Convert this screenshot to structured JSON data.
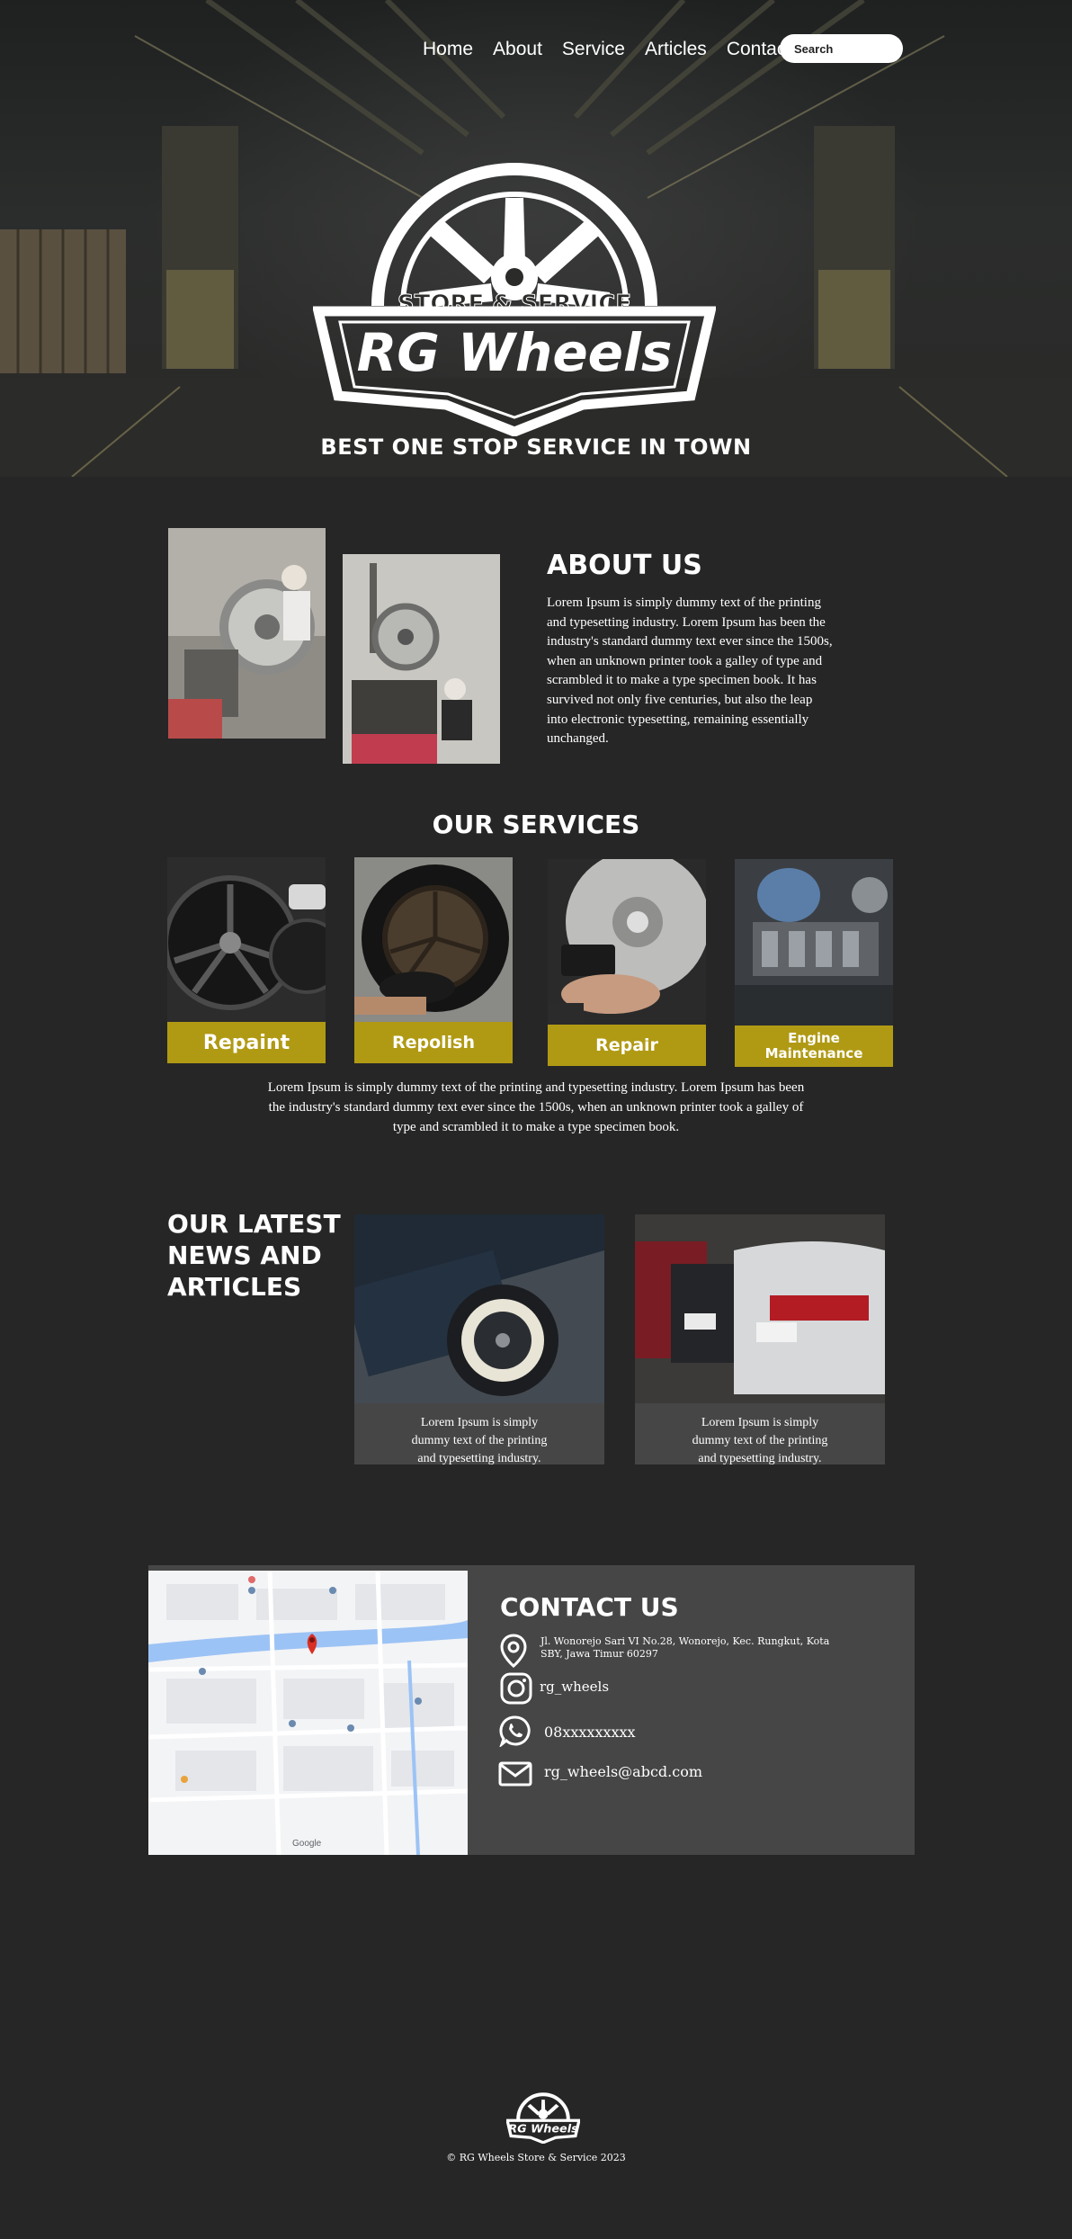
{
  "colors": {
    "background": "#262626",
    "panel": "#464646",
    "accent": "#b09a14",
    "text": "#ffffff"
  },
  "nav": {
    "items": [
      "Home",
      "About",
      "Service",
      "Articles",
      "Contact"
    ],
    "search_placeholder": "Search"
  },
  "hero": {
    "logo_store": "STORE & SERVICE",
    "logo_brand": "RG Wheels",
    "tagline": "BEST ONE STOP SERVICE IN TOWN"
  },
  "about": {
    "title": "ABOUT US",
    "text": "Lorem Ipsum is simply dummy text of the printing and typesetting industry. Lorem Ipsum has been the industry's standard dummy text ever since the 1500s, when an unknown printer took a galley of type and scrambled it to make a type specimen book. It has survived not only five centuries, but also the leap into electronic typesetting, remaining essentially unchanged."
  },
  "services": {
    "title": "OUR SERVICES",
    "items": [
      "Repaint",
      "Repolish",
      "Repair",
      "Engine Maintenance"
    ],
    "text": "Lorem Ipsum is simply dummy text of the printing and typesetting industry. Lorem Ipsum has been the industry's standard dummy text ever since the 1500s, when an unknown printer took a galley of type and scrambled it to make a type specimen book."
  },
  "news": {
    "title": "OUR LATEST NEWS AND ARTICLES",
    "articles": [
      {
        "text": "Lorem Ipsum is simply dummy text of the printing and typesetting industry."
      },
      {
        "text": "Lorem Ipsum is simply dummy text of the printing and typesetting industry."
      }
    ]
  },
  "contact": {
    "title": "CONTACT US",
    "address": "Jl. Wonorejo Sari VI No.28, Wonorejo, Kec. Rungkut, Kota SBY, Jawa Timur 60297",
    "instagram": "rg_wheels",
    "whatsapp": "08xxxxxxxxx",
    "email": "rg_wheels@abcd.com",
    "map_attribution": "Google"
  },
  "footer": {
    "copyright": "© RG Wheels Store & Service 2023"
  },
  "icons": {
    "location": "location-pin-icon",
    "instagram": "instagram-icon",
    "whatsapp": "whatsapp-icon",
    "email": "envelope-icon"
  }
}
